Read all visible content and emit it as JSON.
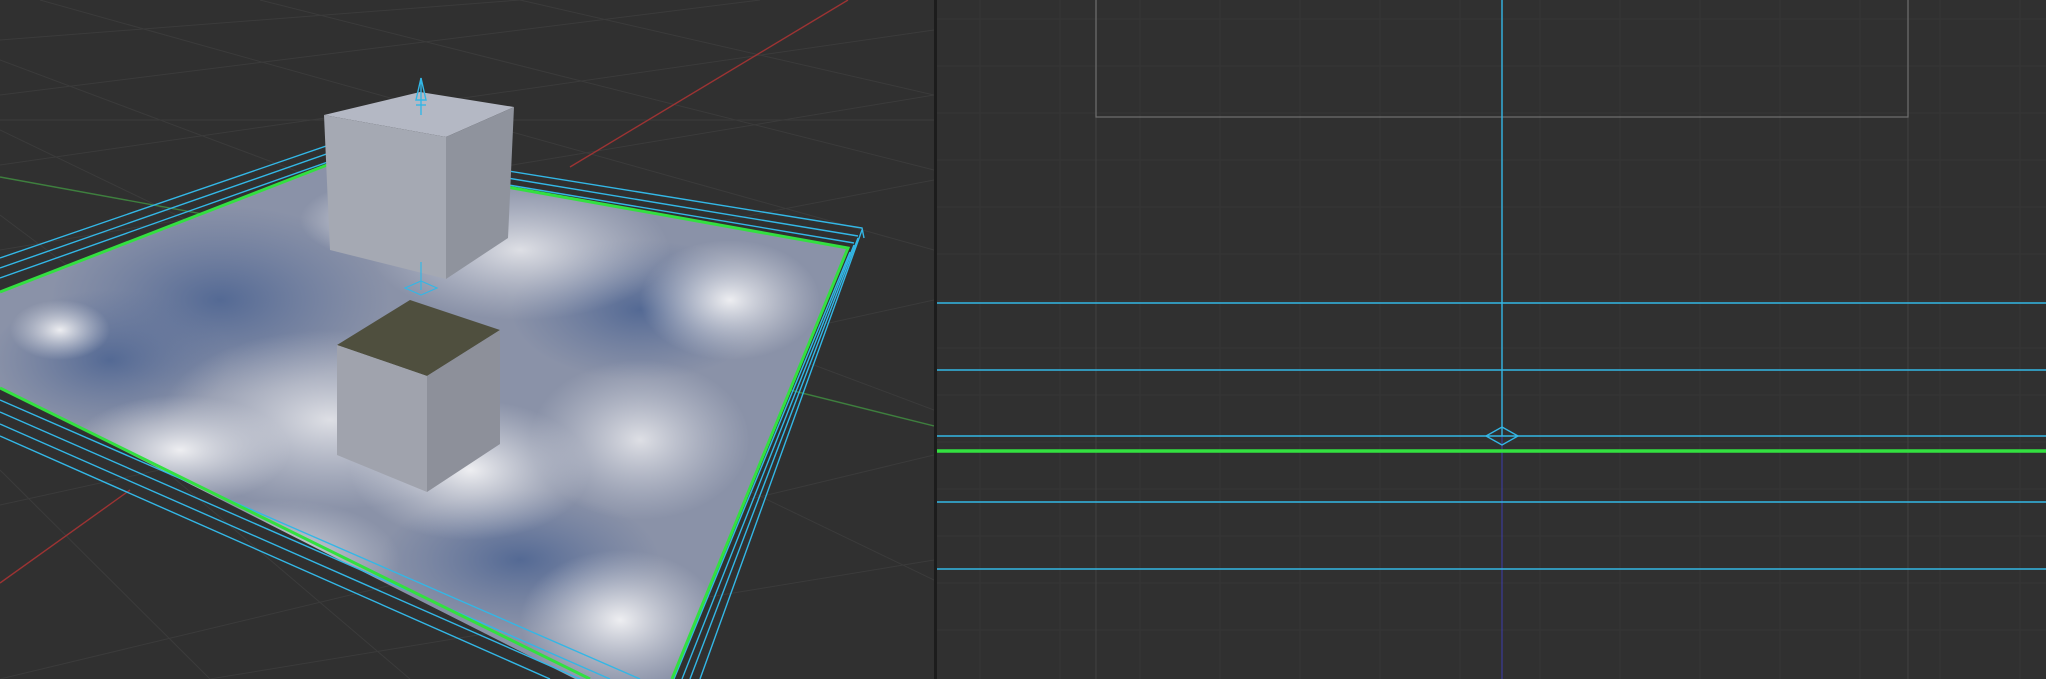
{
  "app": {
    "theme": "dark"
  },
  "colors": {
    "background": "#303030",
    "grid_minor": "#3a3a3a",
    "grid_major": "#454545",
    "axis_x": "#9c3333",
    "axis_y": "#3e7f3e",
    "axis_z": "#3a3a8a",
    "selection_active": "#33e040",
    "selection_other": "#33b7e6",
    "camera_frame": "#6e6e6e",
    "cube_top": "#b3b7c3",
    "cube_left": "#a4a8b2",
    "cube_right": "#8e929c",
    "reflection_top": "#4f4f3e"
  },
  "viewports": {
    "perspective": {
      "objects": [
        "cube",
        "reflection-plane",
        "probe-volume",
        "empty-arrow"
      ],
      "selected": "reflection-plane"
    },
    "orthographic": {
      "objects": [
        "camera-frame",
        "probe-volume",
        "reflection-plane",
        "empty"
      ],
      "selected": "reflection-plane"
    }
  }
}
